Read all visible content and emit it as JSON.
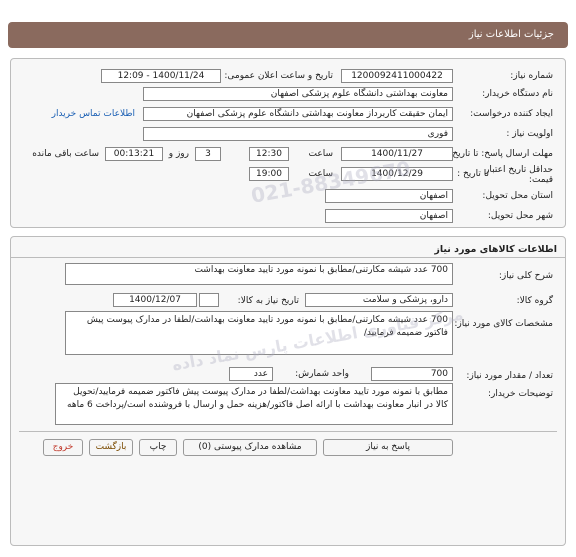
{
  "header": {
    "title": "جزئیات اطلاعات نیاز"
  },
  "details": {
    "need_number_label": "شماره نیاز:",
    "need_number": "1200092411000422",
    "announce_label": "تاریخ و ساعت اعلان عمومی:",
    "announce_value": "1400/11/24 - 12:09",
    "buyer_org_label": "نام دستگاه خریدار:",
    "buyer_org": "معاونت بهداشتی دانشگاه علوم پزشکی اصفهان",
    "creator_label": "ایجاد کننده درخواست:",
    "creator": "ایمان حقیقت کاربرداز معاونت بهداشتی دانشگاه علوم پزشکی اصفهان",
    "contact_link": "اطلاعات تماس خریدار",
    "priority_label": "اولویت نیاز :",
    "priority": "فوری",
    "reply_deadline_label": "مهلت ارسال پاسخ: تا تاریخ :",
    "reply_date": "1400/11/27",
    "time_label": "ساعت",
    "reply_time": "12:30",
    "days": "3",
    "days_label": "روز و",
    "remaining_time": "00:13:21",
    "remaining_label": "ساعت باقی مانده",
    "price_validity_label_1": "حداقل تاریخ اعتبار",
    "price_validity_label_2": "قیمت:",
    "price_until_label": "تا تاریخ :",
    "price_date": "1400/12/29",
    "price_time_label": "ساعت",
    "price_time": "19:00",
    "province_label": "استان محل تحویل:",
    "province": "اصفهان",
    "city_label": "شهر محل تحویل:",
    "city": "اصفهان"
  },
  "goods": {
    "section_title": "اطلاعات کالاهای مورد نیاز",
    "summary_label": "شرح کلی نیاز:",
    "summary": "700 عدد شیشه مکارتنی/مطابق با نمونه مورد تایید معاونت بهداشت",
    "group_label": "گروه کالا:",
    "group": "دارو، پزشکی و سلامت",
    "need_date_label": "تاریخ نیاز به کالا:",
    "need_date": "1400/12/07",
    "spec_label": "مشخصات کالای مورد نیاز:",
    "spec": "700 عدد شیشه مکارتنی/مطابق با نمونه مورد تایید معاونت بهداشت/لطفا در مدارک پیوست پیش فاکتور ضمیمه فرمایید/",
    "qty_label": "تعداد / مقدار مورد نیاز:",
    "qty": "700",
    "unit_label": "واحد شمارش:",
    "unit": "عدد",
    "buyer_notes_label": "توضیحات خریدار:",
    "buyer_notes": "مطابق با نمونه مورد تایید معاونت بهداشت/لطفا در مدارک پیوست پیش فاکتور ضمیمه فرمایید/تحویل کالا در انبار معاونت بهداشت با ارائه اصل فاکتور/هزینه حمل و ارسال با فروشنده است/پرداخت 6 ماهه"
  },
  "actions": {
    "reply": "پاسخ به نیاز",
    "attachments": "مشاهده مدارک پیوستی (0)",
    "print": "چاپ",
    "back": "بازگشت",
    "exit": "خروج"
  },
  "watermark": {
    "line1": "مرکز فناوری اطلاعات پارس نماد داده",
    "line2": "021-88349670"
  },
  "colors": {
    "header": "#8a6a5e",
    "link": "#1a5fb4"
  }
}
